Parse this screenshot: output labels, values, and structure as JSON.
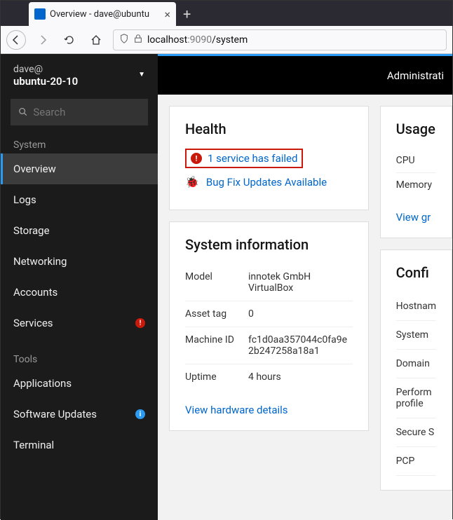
{
  "browser": {
    "tab_title": "Overview - dave@ubuntu",
    "url_host": "localhost",
    "url_port": ":9090",
    "url_path": "/system",
    "new_tab": "+"
  },
  "topbar": {
    "admin_label": "Administrati"
  },
  "sidebar": {
    "user": "dave@",
    "host": "ubuntu-20-10",
    "search_placeholder": "Search",
    "system_section": "System",
    "tools_section": "Tools",
    "items": [
      {
        "label": "Overview"
      },
      {
        "label": "Logs"
      },
      {
        "label": "Storage"
      },
      {
        "label": "Networking"
      },
      {
        "label": "Accounts"
      },
      {
        "label": "Services"
      }
    ],
    "tools": [
      {
        "label": "Applications"
      },
      {
        "label": "Software Updates"
      },
      {
        "label": "Terminal"
      }
    ]
  },
  "health": {
    "title": "Health",
    "service_failed": "1 service has failed",
    "updates": "Bug Fix Updates Available"
  },
  "sysinfo": {
    "title": "System information",
    "rows": [
      {
        "label": "Model",
        "value": "innotek GmbH VirtualBox"
      },
      {
        "label": "Asset tag",
        "value": "0"
      },
      {
        "label": "Machine ID",
        "value": "fc1d0aa357044c0fa9e2b247258a18a1"
      },
      {
        "label": "Uptime",
        "value": "4 hours"
      }
    ],
    "hardware_link": "View hardware details"
  },
  "usage": {
    "title": "Usage",
    "cpu": "CPU",
    "memory": "Memory",
    "view_link": "View gr"
  },
  "config": {
    "title": "Confi",
    "rows": [
      "Hostnam",
      "System",
      "Domain",
      "Perform profile",
      "Secure S",
      "PCP"
    ]
  }
}
